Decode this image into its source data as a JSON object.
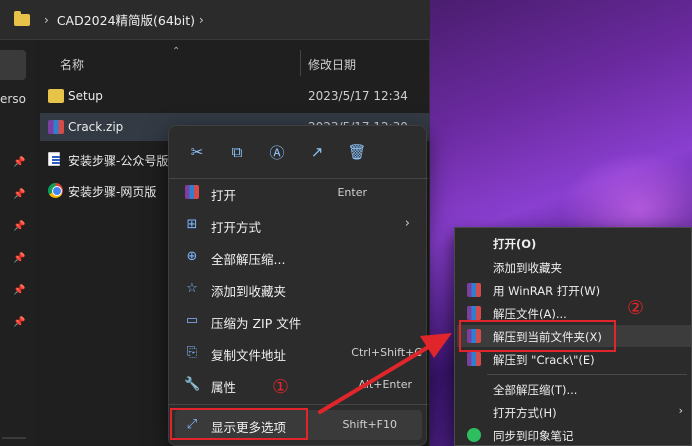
{
  "explorer": {
    "breadcrumb": "CAD2024精简版(64bit)",
    "nav_fragment": "erso",
    "column_name": "名称",
    "column_date": "修改日期",
    "files": [
      {
        "name": "Setup",
        "date": "2023/5/17 12:34",
        "icon": "folder-icon"
      },
      {
        "name": "Crack.zip",
        "date": "2023/5/17 12:30",
        "icon": "winrar-icon"
      },
      {
        "name": "安装步骤-公众号版",
        "date": "",
        "icon": "document-icon"
      },
      {
        "name": "安装步骤-网页版",
        "date": "",
        "icon": "chrome-icon"
      }
    ]
  },
  "context_menu": {
    "quick_actions": [
      "cut-icon",
      "copy-icon",
      "rename-icon",
      "share-icon",
      "delete-icon"
    ],
    "items": [
      {
        "label": "打开",
        "shortcut": "Enter"
      },
      {
        "label": "打开方式",
        "shortcut": ""
      },
      {
        "label": "全部解压缩...",
        "shortcut": ""
      },
      {
        "label": "添加到收藏夹",
        "shortcut": ""
      },
      {
        "label": "压缩为 ZIP 文件",
        "shortcut": ""
      },
      {
        "label": "复制文件地址",
        "shortcut": "Ctrl+Shift+C"
      },
      {
        "label": "属性",
        "shortcut": "Alt+Enter"
      },
      {
        "label": "显示更多选项",
        "shortcut": "Shift+F10"
      }
    ]
  },
  "classic_menu": {
    "items": [
      {
        "label": "打开(O)"
      },
      {
        "label": "添加到收藏夹"
      },
      {
        "label": "用 WinRAR 打开(W)"
      },
      {
        "label": "解压文件(A)..."
      },
      {
        "label": "解压到当前文件夹(X)"
      },
      {
        "label": "解压到 \"Crack\\\"(E)"
      },
      {
        "label": "全部解压缩(T)..."
      },
      {
        "label": "打开方式(H)"
      },
      {
        "label": "同步到印象笔记"
      }
    ]
  },
  "annotations": {
    "step1": "①",
    "step2": "②",
    "highlight_color": "#e0262b"
  }
}
